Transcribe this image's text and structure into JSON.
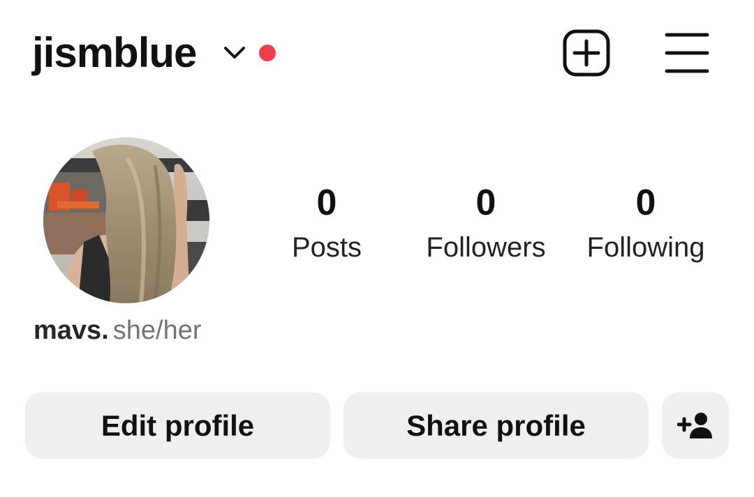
{
  "header": {
    "username": "jismblue",
    "notification_dot_color": "#ed3e4c",
    "icons": {
      "switch_account": "chevron-down-icon",
      "new_post": "add-square-icon",
      "menu": "hamburger-menu-icon"
    }
  },
  "profile": {
    "avatar": "profile-photo"
  },
  "stats": [
    {
      "count": "0",
      "label": "Posts"
    },
    {
      "count": "0",
      "label": "Followers"
    },
    {
      "count": "0",
      "label": "Following"
    }
  ],
  "bio": {
    "name": "mavs.",
    "pronouns": "she/her"
  },
  "actions": {
    "edit_label": "Edit profile",
    "share_label": "Share profile",
    "discover_people_icon": "person-add-icon",
    "button_bg": "#efefef"
  }
}
